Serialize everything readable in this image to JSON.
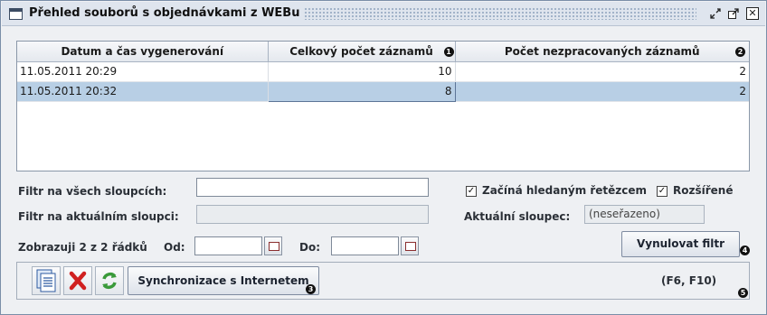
{
  "window": {
    "title": "Přehled souborů s objednávkami z WEBu",
    "title_icon": "window-icon",
    "buttons": [
      "minimize-icon",
      "maximize-icon",
      "close-icon"
    ]
  },
  "table": {
    "columns": [
      "Datum a čas vygenerování",
      "Celkový počet záznamů",
      "Počet nezpracovaných záznamů"
    ],
    "rows": [
      {
        "date": "11.05.2011 20:29",
        "total": "10",
        "unprocessed": "2",
        "selected": false
      },
      {
        "date": "11.05.2011 20:32",
        "total": "8",
        "unprocessed": "2",
        "selected": true
      }
    ]
  },
  "badges": {
    "b1": "1",
    "b2": "2",
    "b3": "3",
    "b4": "4",
    "b5": "5"
  },
  "filters": {
    "all_columns_label": "Filtr na všech sloupcích:",
    "all_columns_value": "",
    "current_column_label": "Filtr na aktuálním sloupci:",
    "current_column_value": "",
    "starts_with_label": "Začíná hledaným řetězcem",
    "starts_with_checked": true,
    "extended_label": "Rozšířené",
    "extended_checked": true,
    "current_column_caption": "Aktuální sloupec:",
    "current_column_name": "(neseřazeno)",
    "showing_label": "Zobrazuji 2 z 2 řádků",
    "from_label": "Od:",
    "from_value": "",
    "to_label": "Do:",
    "to_value": "",
    "reset_button": "Vynulovat filtr"
  },
  "toolbar": {
    "sync_button": "Synchronizace s Internetem",
    "shortcut_hint": "(F6, F10)",
    "icons": [
      "document-list-icon",
      "delete-icon",
      "refresh-icon"
    ]
  },
  "colors": {
    "selected_row": "#b8cfe5",
    "title_bar": "#dfe5ee",
    "delete_red": "#d02020",
    "refresh_green": "#3a9a3a"
  }
}
